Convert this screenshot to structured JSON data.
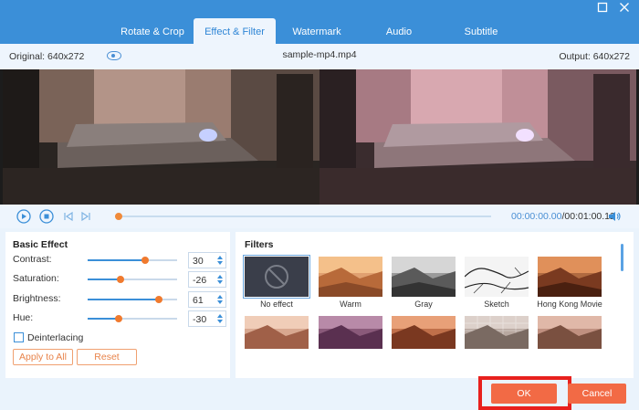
{
  "tabs": [
    {
      "label": "Rotate & Crop"
    },
    {
      "label": "Effect & Filter"
    },
    {
      "label": "Watermark"
    },
    {
      "label": "Audio"
    },
    {
      "label": "Subtitle"
    }
  ],
  "active_tab": "Effect & Filter",
  "info": {
    "original": "Original: 640x272",
    "file_name": "sample-mp4.mp4",
    "output": "Output: 640x272"
  },
  "playback": {
    "current_time": "00:00:00.00",
    "total_time": "/00:01:00.12",
    "progress": 0
  },
  "basic_effect": {
    "title": "Basic Effect",
    "controls": [
      {
        "name": "Contrast:",
        "value": "30",
        "level": 0.64
      },
      {
        "name": "Saturation:",
        "value": "-26",
        "level": 0.37
      },
      {
        "name": "Brightness:",
        "value": "61",
        "level": 0.8
      },
      {
        "name": "Hue:",
        "value": "-30",
        "level": 0.35
      }
    ],
    "deinterlacing_label": "Deinterlacing",
    "deinterlacing_checked": false,
    "apply_all_label": "Apply to All",
    "reset_label": "Reset"
  },
  "filters": {
    "title": "Filters",
    "items": [
      {
        "name": "No effect"
      },
      {
        "name": "Warm"
      },
      {
        "name": "Gray"
      },
      {
        "name": "Sketch"
      },
      {
        "name": "Hong Kong Movie"
      }
    ]
  },
  "buttons": {
    "ok": "OK",
    "cancel": "Cancel"
  },
  "colors": {
    "primary": "#3b8fd8",
    "accent": "#f26a45",
    "highlight_frame": "#e8201d"
  }
}
